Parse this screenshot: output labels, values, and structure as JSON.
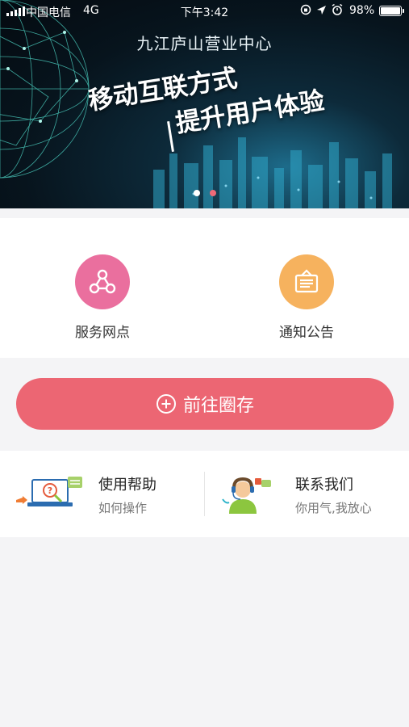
{
  "status_bar": {
    "carrier": "中国电信",
    "network": "4G",
    "time": "下午3:42",
    "battery": "98%"
  },
  "banner": {
    "site_name": "九江庐山营业中心",
    "headline1": "移动互联方式",
    "headline2": "提升用户体验",
    "slide_count": 2,
    "active_slide": 2
  },
  "features": [
    {
      "label": "服务网点",
      "icon": "share-nodes-icon",
      "color": "#ea6f9e"
    },
    {
      "label": "通知公告",
      "icon": "notice-board-icon",
      "color": "#f6b25e"
    }
  ],
  "primary_action": {
    "label": "前往圈存",
    "icon": "plus-circle-icon",
    "color": "#ec6673"
  },
  "help": [
    {
      "title": "使用帮助",
      "subtitle": "如何操作",
      "icon": "help-laptop-icon"
    },
    {
      "title": "联系我们",
      "subtitle": "你用气,我放心",
      "icon": "customer-service-icon"
    }
  ]
}
